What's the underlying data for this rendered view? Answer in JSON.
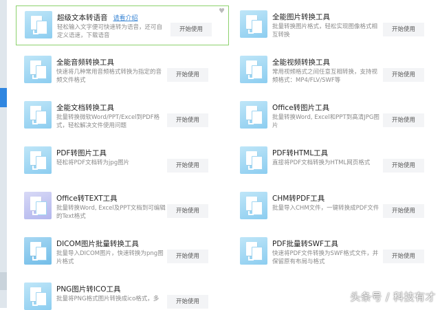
{
  "tools": [
    {
      "title": "超级文本转语音",
      "link": "请看介绍",
      "desc": "轻松输入文字便可快速转为语音，还可自定义语速，下载语音",
      "button": "开始使用",
      "favorite": true
    },
    {
      "title": "全能图片转换工具",
      "desc": "批量转换图片格式，轻松实现图像格式相互转换",
      "button": "开始使用"
    },
    {
      "title": "全能音频转换工具",
      "desc": "快速将几种常用音频格式转换为指定的音频文件格式",
      "button": "开始使用"
    },
    {
      "title": "全能视频转换工具",
      "desc": "常用视频格式之间任意互相转换，支持视频格式：MP4/FLV/SWF等",
      "button": "开始使用"
    },
    {
      "title": "全能文档转换工具",
      "desc": "批量转换微软Word/PPT/Excel到PDF格式，轻松解决文件使用问题",
      "button": "开始使用"
    },
    {
      "title": "Office转图片工具",
      "desc": "批量转换Word, Excel和PPT到高清JPG图片",
      "button": "开始使用"
    },
    {
      "title": "PDF转图片工具",
      "desc": "轻松将PDF文档转为jpg图片",
      "button": "开始使用"
    },
    {
      "title": "PDF转HTML工具",
      "desc": "直接将PDF文档转换为HTML网页格式",
      "button": "开始使用"
    },
    {
      "title": "Office转TEXT工具",
      "desc": "批量转换Word, Excel及PPT文档到可编辑的Text格式",
      "button": "开始使用"
    },
    {
      "title": "CHM转PDF工具",
      "desc": "批量导入CHM文件，一键转换成PDF文件",
      "button": "开始使用"
    },
    {
      "title": "DICOM图片批量转换工具",
      "desc": "批量导入DICOM图片，快速转换为png图片格式",
      "button": "开始使用"
    },
    {
      "title": "PDF批量转SWF工具",
      "desc": "快速将PDF文件转换为SWF格式文件，并保留原有布局与格式",
      "button": "开始使用"
    },
    {
      "title": "PNG图片转ICO工具",
      "desc": "批量将PNG格式图片转换成ico格式，多",
      "button": "开始使用"
    }
  ],
  "watermark": "头条号 / 科技有才"
}
